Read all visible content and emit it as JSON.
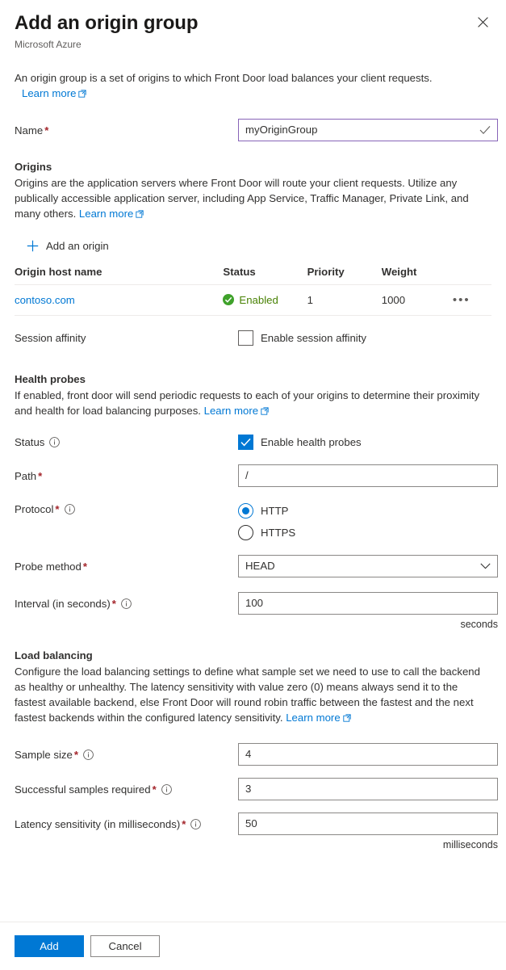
{
  "header": {
    "title": "Add an origin group",
    "subtitle": "Microsoft Azure",
    "close_label": "Close",
    "close_icon": "close-icon"
  },
  "intro": {
    "text": "An origin group is a set of origins to which Front Door load balances your client requests.",
    "learn_more": "Learn more"
  },
  "name_field": {
    "label": "Name",
    "required_mark": "*",
    "value": "myOriginGroup",
    "valid_icon": "checkmark-icon",
    "border_color": "#8764b8"
  },
  "origins": {
    "title": "Origins",
    "description": "Origins are the application servers where Front Door will route your client requests. Utilize any publically accessible application server, including App Service, Traffic Manager, Private Link, and many others.",
    "learn_more": "Learn more",
    "add_button": "Add an origin",
    "add_icon": "plus-icon",
    "columns": [
      "Origin host name",
      "Status",
      "Priority",
      "Weight"
    ],
    "rows": [
      {
        "host": "contoso.com",
        "status": "Enabled",
        "status_icon": "check-circle-icon",
        "status_color": "#498205",
        "priority": "1",
        "weight": "1000",
        "menu_icon": "ellipsis-icon"
      }
    ]
  },
  "session_affinity": {
    "label": "Session affinity",
    "checkbox_label": "Enable session affinity",
    "checked": false
  },
  "health_probes": {
    "title": "Health probes",
    "description": "If enabled, front door will send periodic requests to each of your origins to determine their proximity and health for load balancing purposes.",
    "learn_more": "Learn more",
    "status": {
      "label": "Status",
      "info_icon": "info-icon",
      "checkbox_label": "Enable health probes",
      "checked": true
    },
    "path": {
      "label": "Path",
      "required_mark": "*",
      "value": "/"
    },
    "protocol": {
      "label": "Protocol",
      "required_mark": "*",
      "info_icon": "info-icon",
      "options": [
        "HTTP",
        "HTTPS"
      ],
      "selected": "HTTP"
    },
    "probe_method": {
      "label": "Probe method",
      "required_mark": "*",
      "value": "HEAD",
      "chevron_icon": "chevron-down-icon"
    },
    "interval": {
      "label": "Interval (in seconds)",
      "required_mark": "*",
      "info_icon": "info-icon",
      "value": "100",
      "suffix": "seconds"
    }
  },
  "load_balancing": {
    "title": "Load balancing",
    "description": "Configure the load balancing settings to define what sample set we need to use to call the backend as healthy or unhealthy. The latency sensitivity with value zero (0) means always send it to the fastest available backend, else Front Door will round robin traffic between the fastest and the next fastest backends within the configured latency sensitivity.",
    "learn_more": "Learn more",
    "sample_size": {
      "label": "Sample size",
      "required_mark": "*",
      "info_icon": "info-icon",
      "value": "4"
    },
    "successful_samples": {
      "label": "Successful samples required",
      "required_mark": "*",
      "info_icon": "info-icon",
      "value": "3"
    },
    "latency_sensitivity": {
      "label": "Latency sensitivity (in milliseconds)",
      "required_mark": "*",
      "info_icon": "info-icon",
      "value": "50",
      "suffix": "milliseconds"
    }
  },
  "footer": {
    "add_label": "Add",
    "cancel_label": "Cancel",
    "primary_color": "#0078d4"
  }
}
